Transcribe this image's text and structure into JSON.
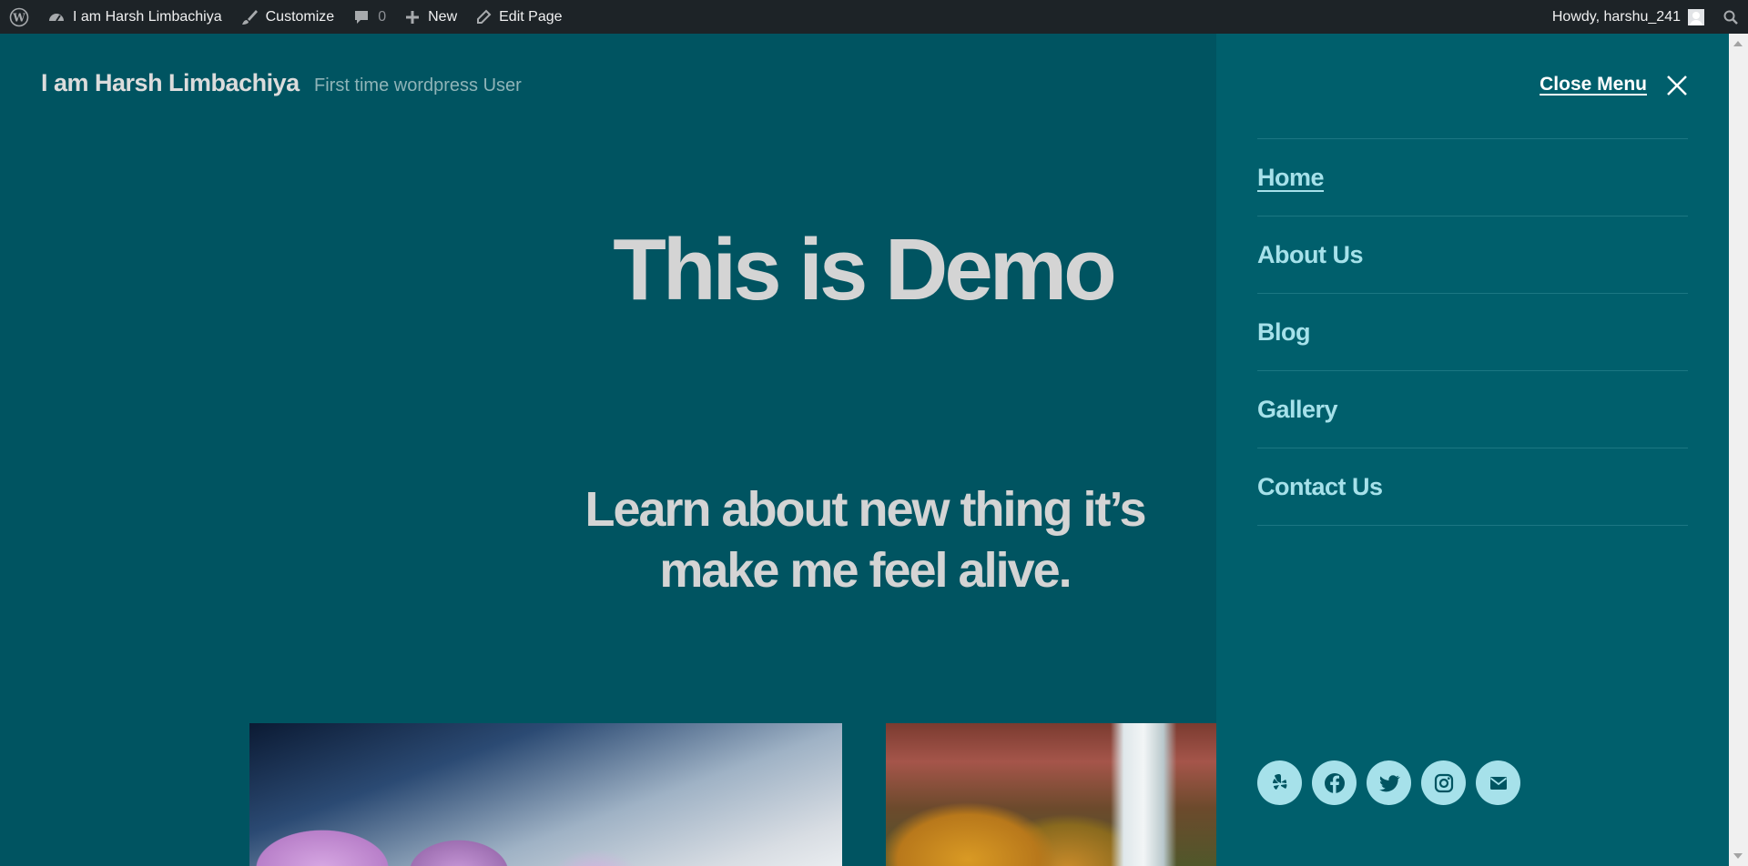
{
  "adminbar": {
    "site_name": "I am Harsh Limbachiya",
    "customize": "Customize",
    "comments_count": "0",
    "new": "New",
    "edit_page": "Edit Page",
    "howdy": "Howdy, harshu_241"
  },
  "site": {
    "title": "I am Harsh Limbachiya",
    "description": "First time wordpress User"
  },
  "hero": {
    "title": "This is Demo",
    "subtitle": "Learn about new thing it’s make me feel alive."
  },
  "menu": {
    "close_label": "Close Menu",
    "items": [
      {
        "label": "Home",
        "current": true
      },
      {
        "label": "About Us"
      },
      {
        "label": "Blog"
      },
      {
        "label": "Gallery"
      },
      {
        "label": "Contact Us"
      }
    ],
    "social": [
      "yelp-icon",
      "facebook-icon",
      "twitter-icon",
      "instagram-icon",
      "mail-icon"
    ]
  },
  "colors": {
    "admin_bar": "#1d2327",
    "page_bg": "#005461",
    "menu_bg": "#005f6c",
    "menu_link": "#a6e1ea",
    "heading": "#d4d4d4"
  }
}
